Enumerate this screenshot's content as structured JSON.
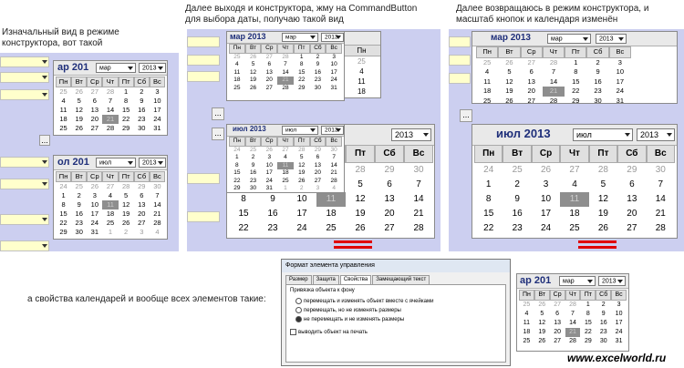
{
  "captions": {
    "c1": "Изначальный вид в режиме конструктора, вот такой",
    "c2": "Далее выходя и конструктора, жму на CommandButton для выбора даты, получаю такой вид",
    "c3": "Далее возвращаюсь в режим конструктора, и масштаб кнопок и календаря изменён",
    "c4": "а свойства календарей и вообще всех элементов такие:"
  },
  "watermark": "www.excelworld.ru",
  "dots_label": "...",
  "weekdays": [
    "Пн",
    "Вт",
    "Ср",
    "Чт",
    "Пт",
    "Сб",
    "Вс"
  ],
  "march_days": [
    "25",
    "26",
    "27",
    "28",
    "1",
    "2",
    "3",
    "4",
    "5",
    "6",
    "7",
    "8",
    "9",
    "10",
    "11",
    "12",
    "13",
    "14",
    "15",
    "16",
    "17",
    "18",
    "19",
    "20",
    "21",
    "22",
    "23",
    "24",
    "25",
    "26",
    "27",
    "28",
    "29",
    "30",
    "31"
  ],
  "march_weeks": [
    [
      "25",
      "26",
      "27",
      "28",
      "1",
      "2",
      "3"
    ],
    [
      "4",
      "5",
      "6",
      "7",
      "8",
      "9",
      "10"
    ],
    [
      "11",
      "12",
      "13",
      "14",
      "15",
      "16",
      "17"
    ],
    [
      "18",
      "19",
      "20",
      "21",
      "22",
      "23",
      "24"
    ],
    [
      "25",
      "26",
      "27",
      "28",
      "29",
      "30",
      "31"
    ]
  ],
  "july_weeks": [
    [
      "24",
      "25",
      "26",
      "27",
      "28",
      "29",
      "30"
    ],
    [
      "1",
      "2",
      "3",
      "4",
      "5",
      "6",
      "7"
    ],
    [
      "8",
      "9",
      "10",
      "11",
      "12",
      "13",
      "14"
    ],
    [
      "15",
      "16",
      "17",
      "18",
      "19",
      "20",
      "21"
    ],
    [
      "22",
      "23",
      "24",
      "25",
      "26",
      "27",
      "28"
    ],
    [
      "29",
      "30",
      "31",
      "1",
      "2",
      "3",
      "4"
    ]
  ],
  "calendars": {
    "mar_title": "мар 2013",
    "mar_title_cut": "ар 201",
    "jul_title": "июл 2013",
    "jul_title_cut": "ол 201",
    "month_mar": "мар",
    "month_jul": "июл",
    "year": "2013"
  },
  "dialog": {
    "title": "Формат элемента управления",
    "tabs": [
      "Размер",
      "Защита",
      "Свойства",
      "Замещающий текст"
    ],
    "group": "Привязка объекта к фону",
    "opt1": "перемещать и изменять объект вместе с ячейками",
    "opt2": "перемещать, но не изменять размеры",
    "opt3": "не перемещать и не изменять размеры",
    "print": "выводить объект на печать"
  }
}
